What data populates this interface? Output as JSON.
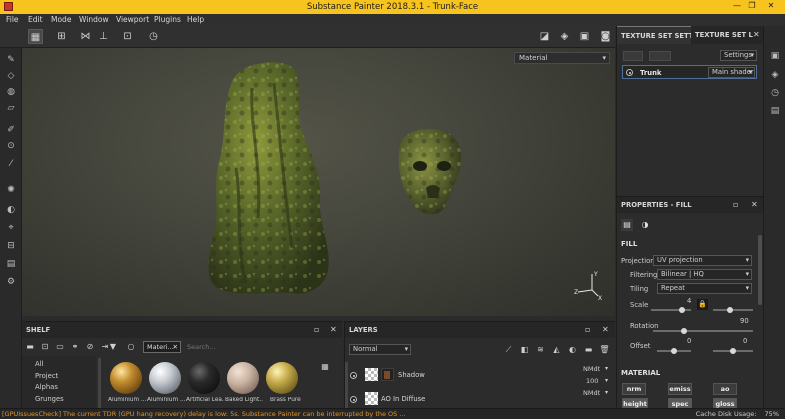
{
  "window": {
    "title": "Substance Painter 2018.3.1 - Trunk-Face"
  },
  "menu": [
    "File",
    "Edit",
    "Mode",
    "Window",
    "Viewport",
    "Plugins",
    "Help"
  ],
  "viewport": {
    "channel_select": "Material"
  },
  "texture_set_settings": {
    "tab_label": "TEXTURE SET SETTI...",
    "list_tab_label": "TEXTURE SET L...",
    "settings_button": "Settings",
    "texture_set_name": "Trunk",
    "shader": "Main shader"
  },
  "properties": {
    "title": "PROPERTIES - FILL",
    "fill_section": "FILL",
    "projection_label": "Projection",
    "projection_value": "UV projection",
    "filtering_label": "Filtering",
    "filtering_value": "Bilinear | HQ",
    "tiling_label": "Tiling",
    "tiling_value": "Repeat",
    "scale_label": "Scale",
    "scale_value": "4",
    "rotation_label": "Rotation",
    "rotation_value": "90",
    "offset_label": "Offset",
    "offset_x": "0",
    "offset_y": "0",
    "material_section": "MATERIAL",
    "material_buttons": [
      "nrm",
      "emiss",
      "ao",
      "height",
      "spec",
      "gloss"
    ]
  },
  "shelf": {
    "title": "SHELF",
    "categories": [
      "All",
      "Project",
      "Alphas",
      "Grunges"
    ],
    "filter_chip": "Materi...",
    "search_placeholder": "Search...",
    "materials": [
      {
        "name": "Aluminium ...",
        "color": "#b8862a"
      },
      {
        "name": "Aluminium ...",
        "color": "#b7bcc2"
      },
      {
        "name": "Artificial Lea...",
        "color": "#1c1c1c"
      },
      {
        "name": "Baked Light...",
        "color": "#c9b2a0"
      },
      {
        "name": "Brass Pure",
        "color": "#b9a042"
      }
    ]
  },
  "layers": {
    "title": "LAYERS",
    "blend_mode": "Normal",
    "items": [
      {
        "name": "Shadow",
        "blend": "NMdt",
        "opacity": "100"
      },
      {
        "name": "AO In Diffuse",
        "blend": "NMdt"
      }
    ]
  },
  "statusbar": {
    "message": "[GPUIssuesCheck] The current TDR (GPU hang recovery) delay is low: 5s. Substance Painter can be interrupted by the OS ...",
    "cache_label": "Cache Disk Usage:",
    "cache_value": "75%"
  },
  "colors": {
    "titlebar": "#f7c41f",
    "accent": "#4d6f9a",
    "warning": "#e0962a"
  }
}
